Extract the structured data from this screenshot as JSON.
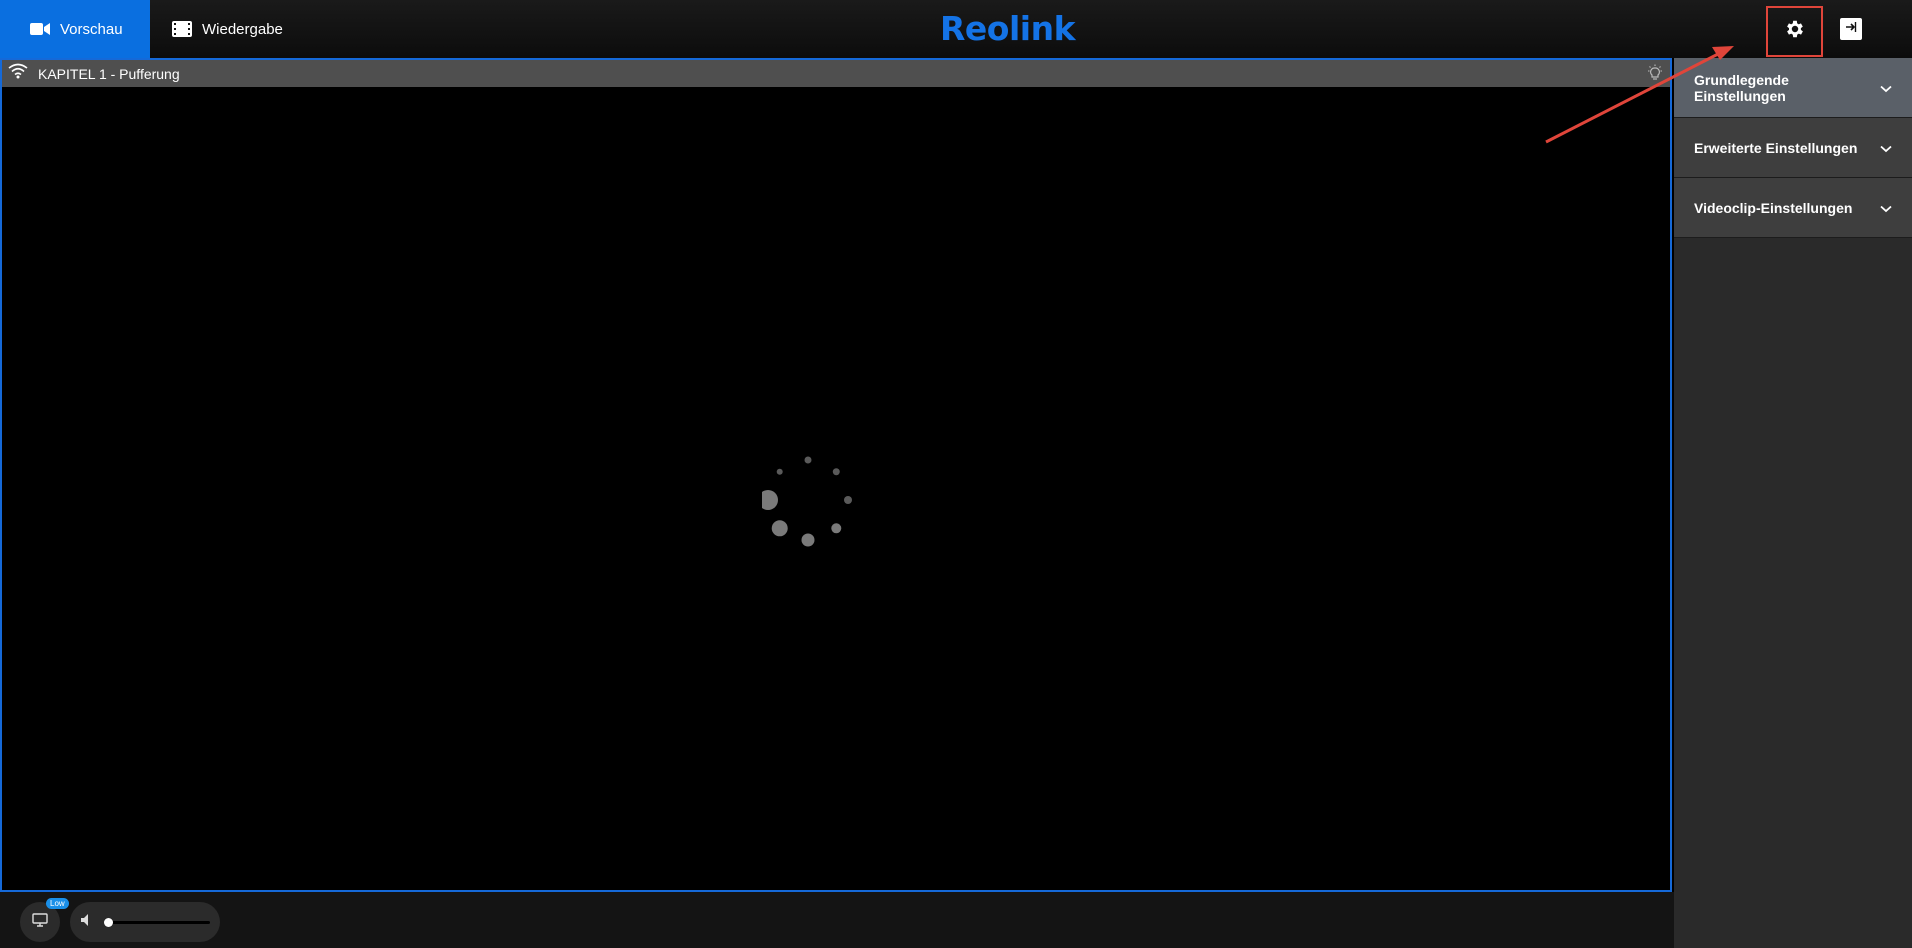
{
  "header": {
    "tabs": [
      {
        "label": "Vorschau",
        "icon": "video-camera-icon",
        "active": true
      },
      {
        "label": "Wiedergabe",
        "icon": "film-icon",
        "active": false
      }
    ],
    "logo": "Reolink",
    "settings_icon": "gear-icon",
    "logout_icon": "logout-icon",
    "highlight_color": "#e0453a"
  },
  "player": {
    "channel_title": "KAPITEL 1 - Pufferung",
    "signal_icon": "wifi-icon",
    "light_icon": "lightbulb-icon",
    "status_icon": "loading-spinner-icon"
  },
  "controls": {
    "stream_badge": "Low",
    "stream_icon": "monitor-icon",
    "volume_icon": "speaker-icon",
    "volume_level": 0.0
  },
  "sidebar": {
    "items": [
      {
        "label": "Grundlegende Einstellungen"
      },
      {
        "label": "Erweiterte Einstellungen"
      },
      {
        "label": "Videoclip-Einstellungen"
      }
    ]
  },
  "colors": {
    "accent": "#0a6fe0",
    "logo": "#1473e6",
    "player_border": "#1569d8"
  }
}
